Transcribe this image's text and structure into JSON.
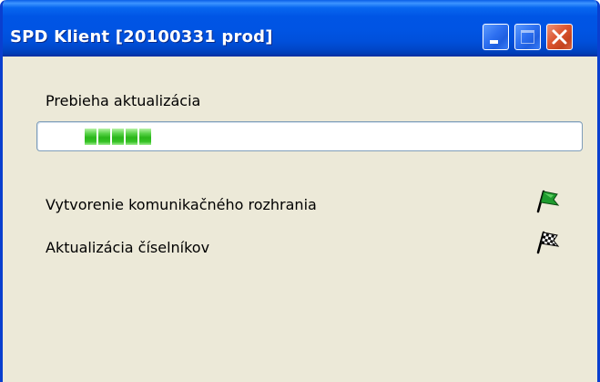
{
  "window": {
    "title": "SPD Klient [20100331 prod]"
  },
  "titlebar_buttons": {
    "minimize": "minimize-icon",
    "maximize": "maximize-icon",
    "close": "close-icon"
  },
  "status": {
    "label": "Prebieha aktualizácia"
  },
  "progress": {
    "style": "marquee",
    "block_count": 5,
    "color": "#2AB61A"
  },
  "steps": [
    {
      "label": "Vytvorenie komunikačného rozhrania",
      "icon": "green-flag-icon"
    },
    {
      "label": "Aktualizácia číselníkov",
      "icon": "checkered-flag-icon"
    }
  ],
  "colors": {
    "titlebar": "#0054E3",
    "window_body": "#ECE9D8",
    "close_button": "#DC5530"
  }
}
